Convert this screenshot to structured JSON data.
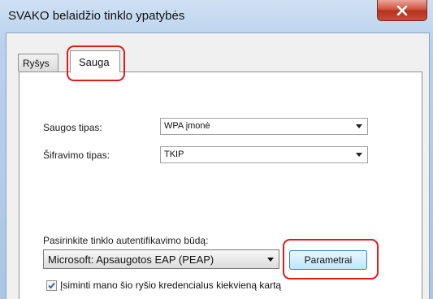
{
  "window": {
    "title": "SVAKO belaidžio tinklo ypatybės",
    "close_icon": "close-icon"
  },
  "tabs": [
    {
      "label": "Ryšys",
      "active": false
    },
    {
      "label": "Sauga",
      "active": true
    }
  ],
  "security": {
    "type_label": "Saugos tipas:",
    "type_value": "WPA įmonė",
    "encryption_label": "Šifravimo tipas:",
    "encryption_value": "TKIP"
  },
  "auth": {
    "prompt": "Pasirinkite tinklo autentifikavimo būdą:",
    "method_value": "Microsoft: Apsaugotos EAP (PEAP)",
    "settings_button": "Parametrai"
  },
  "remember": {
    "checked": true,
    "label": "Įsiminti mano šio ryšio kredencialus kiekvieną kartą"
  },
  "colors": {
    "highlight": "#e01b1b",
    "accent": "#3c7fb1"
  }
}
